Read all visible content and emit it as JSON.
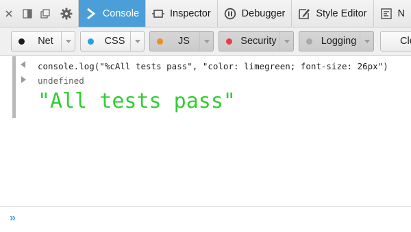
{
  "toolbar": {
    "tabs": [
      {
        "label": "Console",
        "icon": "console-chevron-icon"
      },
      {
        "label": "Inspector",
        "icon": "inspector-icon"
      },
      {
        "label": "Debugger",
        "icon": "debugger-pause-icon"
      },
      {
        "label": "Style Editor",
        "icon": "style-editor-icon"
      },
      {
        "label": "N",
        "icon": "network-icon"
      }
    ]
  },
  "filters": [
    {
      "label": "Net",
      "color": "#1b1b1b"
    },
    {
      "label": "CSS",
      "color": "#1fa3e1"
    },
    {
      "label": "JS",
      "color": "#ef8e1b"
    },
    {
      "label": "Security",
      "color": "#ed3d42"
    },
    {
      "label": "Logging",
      "color": "#a9a9a9"
    },
    {
      "label": "Cle"
    }
  ],
  "console": {
    "command": "console.log(\"%cAll tests pass\", \"color: limegreen; font-size: 26px\")",
    "result": "undefined",
    "log_output": "\"All tests pass\"",
    "log_color": "#32cd32"
  },
  "input": {
    "prompt": "»",
    "value": ""
  }
}
